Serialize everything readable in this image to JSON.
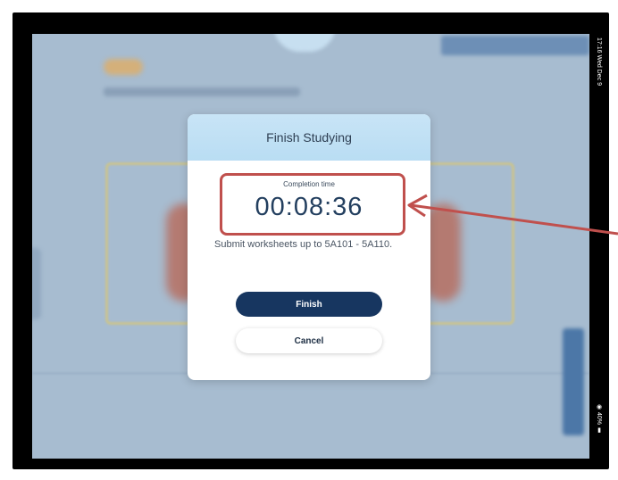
{
  "status_bar": {
    "time": "17:16  Wed Dec 9",
    "battery": "40%"
  },
  "dialog": {
    "title": "Finish Studying",
    "completion_label": "Completion time",
    "completion_time": "00:08:36",
    "message": "Submit worksheets up to 5A101 - 5A110.",
    "finish_label": "Finish",
    "cancel_label": "Cancel"
  },
  "colors": {
    "header_bg": "#bfe0f4",
    "finish_button": "#173660",
    "annotation": "#c0504d",
    "backdrop": "#a7bcd0"
  },
  "icons": [
    "wifi-icon",
    "battery-icon"
  ]
}
